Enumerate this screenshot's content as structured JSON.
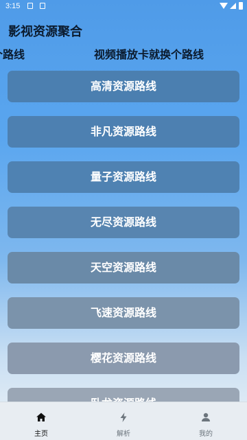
{
  "status_bar": {
    "time": "3:15",
    "icons": [
      "image-icon",
      "app-icon",
      "wifi-icon",
      "signal-icon",
      "battery-icon"
    ]
  },
  "app": {
    "title": "影视资源聚合",
    "marquee": [
      "个路线",
      "视频播放卡就换个路线"
    ]
  },
  "routes": [
    {
      "label": "高清资源路线",
      "color": "#4b7fb0"
    },
    {
      "label": "非凡资源路线",
      "color": "#4d80b1"
    },
    {
      "label": "量子资源路线",
      "color": "#4f82b2"
    },
    {
      "label": "无尽资源路线",
      "color": "#5885b0"
    },
    {
      "label": "天空资源路线",
      "color": "#6a8aa8"
    },
    {
      "label": "飞速资源路线",
      "color": "#7b93ab"
    },
    {
      "label": "樱花资源路线",
      "color": "#8b9aae"
    },
    {
      "label": "卧龙资源路线",
      "color": "#9aa6b5"
    }
  ],
  "bottom_nav": [
    {
      "label": "主页",
      "icon": "home-icon",
      "active": true
    },
    {
      "label": "解析",
      "icon": "lightning-icon",
      "active": false
    },
    {
      "label": "我的",
      "icon": "person-icon",
      "active": false
    }
  ],
  "colors": {
    "background_top": "#4f9be8",
    "nav_background": "#e8edf2",
    "text_dark": "#0b1b2e"
  }
}
